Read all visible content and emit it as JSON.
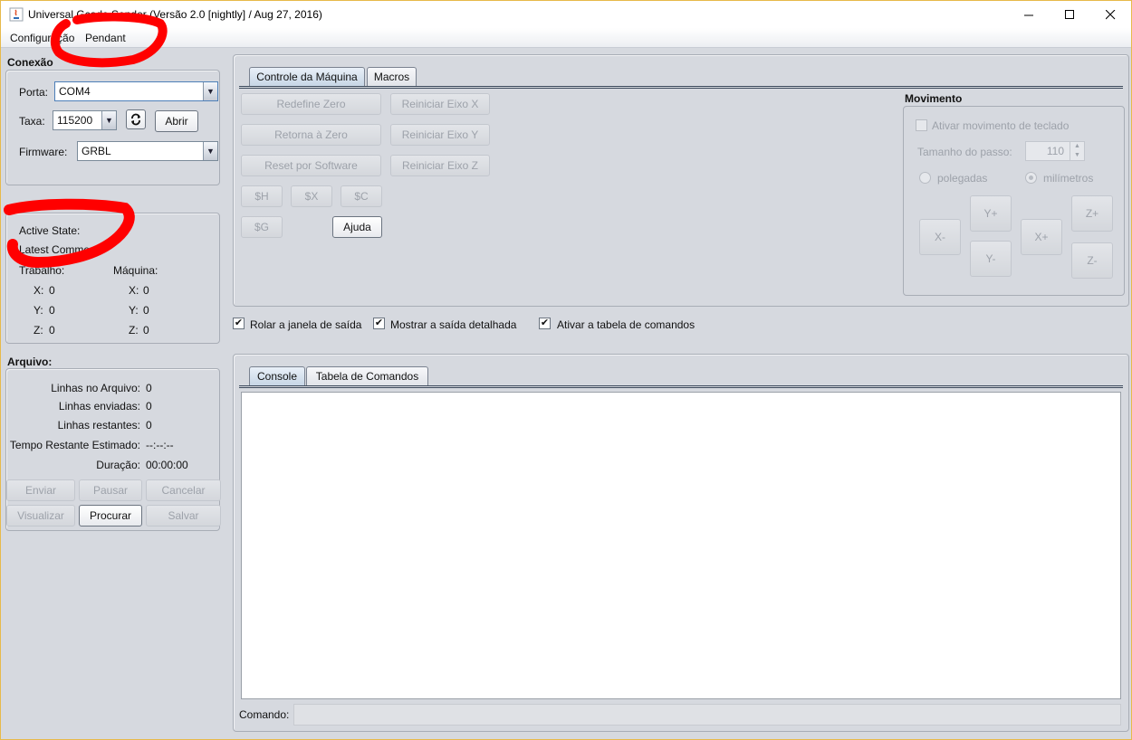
{
  "window": {
    "title": "Universal Gcode Sender (Versão 2.0 [nightly]  / Aug 27, 2016)",
    "icons": [
      "java-app-icon",
      "minimize-icon",
      "maximize-icon",
      "close-icon"
    ]
  },
  "menu": {
    "items": [
      "Configuração",
      "Pendant"
    ]
  },
  "connection": {
    "title": "Conexão",
    "port_label": "Porta:",
    "port_value": "COM4",
    "baud_label": "Taxa:",
    "baud_value": "115200",
    "open_button": "Abrir",
    "firmware_label": "Firmware:",
    "firmware_value": "GRBL"
  },
  "status": {
    "active_state_label": "Active State:",
    "latest_comment_label": "Latest Comment:",
    "work_label": "Trabalho:",
    "machine_label": "Máquina:",
    "work": {
      "x_label": "X:",
      "x": "0",
      "y_label": "Y:",
      "y": "0",
      "z_label": "Z:",
      "z": "0"
    },
    "machine": {
      "x_label": "X:",
      "x": "0",
      "y_label": "Y:",
      "y": "0",
      "z_label": "Z:",
      "z": "0"
    }
  },
  "file": {
    "title": "Arquivo:",
    "rows": [
      {
        "label": "Linhas no Arquivo:",
        "value": "0"
      },
      {
        "label": "Linhas enviadas:",
        "value": "0"
      },
      {
        "label": "Linhas restantes:",
        "value": "0"
      },
      {
        "label": "Tempo Restante Estimado:",
        "value": "--:--:--"
      },
      {
        "label": "Duração:",
        "value": "00:00:00"
      }
    ],
    "buttons": [
      "Enviar",
      "Pausar",
      "Cancelar",
      "Visualizar",
      "Procurar",
      "Salvar"
    ]
  },
  "machine_control": {
    "tabs": [
      "Controle da Máquina",
      "Macros"
    ],
    "buttons": {
      "reset_zero": "Redefine Zero",
      "return_zero": "Retorna à Zero",
      "soft_reset": "Reset por Software",
      "reset_x": "Reiniciar Eixo X",
      "reset_y": "Reiniciar Eixo Y",
      "reset_z": "Reiniciar Eixo Z",
      "home": "$H",
      "kill_alarm": "$X",
      "check_mode": "$C",
      "get_state": "$G",
      "help": "Ajuda"
    }
  },
  "movement": {
    "title": "Movimento",
    "keyboard_label": "Ativar movimento de teclado",
    "step_label": "Tamanho do passo:",
    "step_value": "110",
    "inches_label": "polegadas",
    "mm_label": "milímetros",
    "jog": {
      "x_minus": "X-",
      "y_plus": "Y+",
      "y_minus": "Y-",
      "x_plus": "X+",
      "z_plus": "Z+",
      "z_minus": "Z-"
    }
  },
  "options": {
    "scroll_output": "Rolar a janela de saída",
    "verbose_output": "Mostrar a saída detalhada",
    "command_table": "Ativar a tabela de comandos"
  },
  "console": {
    "tabs": [
      "Console",
      "Tabela de Comandos"
    ],
    "command_label": "Comando:",
    "command_value": ""
  },
  "colors": {
    "annotation": "#ff0000",
    "background": "#d6d9df",
    "tab_selected": "#c7d6e6"
  }
}
